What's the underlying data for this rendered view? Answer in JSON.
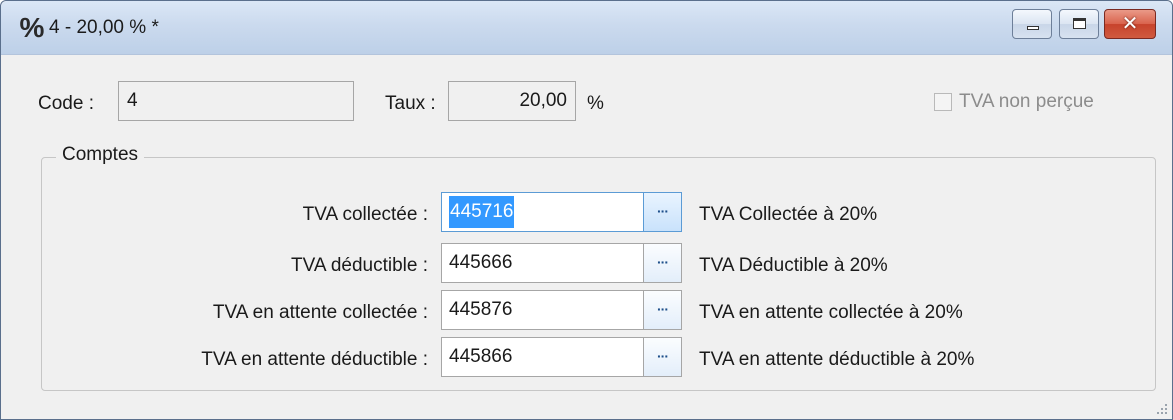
{
  "window": {
    "icon": "percent-icon",
    "icon_glyph": "%",
    "title": "4 - 20,00 % *",
    "close_glyph": "✕"
  },
  "header": {
    "code_label": "Code :",
    "code_value": "4",
    "taux_label": "Taux :",
    "taux_value": "20,00",
    "taux_unit": "%",
    "tva_non_percue_label": "TVA non perçue",
    "tva_non_percue_checked": false
  },
  "comptes": {
    "legend": "Comptes",
    "browse_glyph": "···",
    "rows": [
      {
        "label": "TVA collectée :",
        "account": "445716",
        "description": "TVA Collectée à 20%",
        "selected": true
      },
      {
        "label": "TVA déductible :",
        "account": "445666",
        "description": "TVA Déductible à 20%",
        "selected": false
      },
      {
        "label": "TVA en attente collectée :",
        "account": "445876",
        "description": "TVA en attente collectée à 20%",
        "selected": false
      },
      {
        "label": "TVA en attente déductible :",
        "account": "445866",
        "description": "TVA en attente déductible à 20%",
        "selected": false
      }
    ]
  }
}
